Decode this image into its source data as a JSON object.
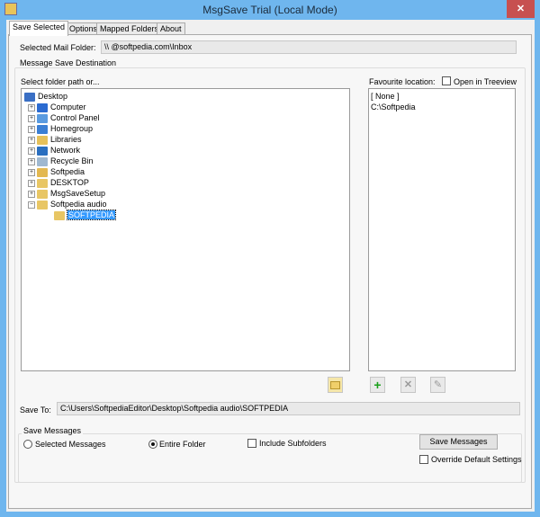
{
  "window": {
    "title": "MsgSave Trial (Local Mode)",
    "close": "✕"
  },
  "tabs": [
    {
      "label": "Save Selected",
      "active": true
    },
    {
      "label": "Options"
    },
    {
      "label": "Mapped Folders"
    },
    {
      "label": "About"
    }
  ],
  "mail_folder": {
    "label": "Selected Mail Folder:",
    "value": "\\\\      @softpedia.com\\Inbox"
  },
  "destination": {
    "group_label": "Message Save Destination",
    "tree_label": "Select folder path or...",
    "tree": [
      {
        "label": "Desktop",
        "icon": "desktop-icon",
        "level": 0,
        "color": "#3a6fc4"
      },
      {
        "label": "Computer",
        "icon": "computer-icon",
        "level": 1,
        "color": "#2b6bd1"
      },
      {
        "label": "Control Panel",
        "icon": "control-panel-icon",
        "level": 1,
        "color": "#5a9be0"
      },
      {
        "label": "Homegroup",
        "icon": "homegroup-icon",
        "level": 1,
        "color": "#3b7fd4"
      },
      {
        "label": "Libraries",
        "icon": "libraries-icon",
        "level": 1,
        "color": "#e6c15a"
      },
      {
        "label": "Network",
        "icon": "network-icon",
        "level": 1,
        "color": "#2a6fc0"
      },
      {
        "label": "Recycle Bin",
        "icon": "recycle-bin-icon",
        "level": 1,
        "color": "#9fb8d0"
      },
      {
        "label": "Softpedia",
        "icon": "user-folder-icon",
        "level": 1,
        "color": "#e3b850"
      },
      {
        "label": "DESKTOP",
        "icon": "folder-icon",
        "level": 1,
        "color": "#e8c664"
      },
      {
        "label": "MsgSaveSetup",
        "icon": "folder-icon",
        "level": 1,
        "color": "#e8c664"
      },
      {
        "label": "Softpedia audio",
        "icon": "folder-icon",
        "level": 1,
        "expanded": true,
        "color": "#e8c664"
      },
      {
        "label": "SOFTPEDIA",
        "icon": "folder-icon",
        "level": 2,
        "selected": true,
        "color": "#e8c664"
      }
    ],
    "favourite_label": "Favourite location:",
    "open_in_treeview": {
      "label": "Open in Treeview",
      "checked": false
    },
    "favourites": [
      "[ None ]",
      "C:\\Softpedia"
    ]
  },
  "toolbar": {
    "new_folder": "new-folder-icon",
    "add": "+",
    "remove": "✕",
    "edit": "✎"
  },
  "save_to": {
    "label": "Save To:",
    "value": "C:\\Users\\SoftpediaEditor\\Desktop\\Softpedia audio\\SOFTPEDIA"
  },
  "save_messages": {
    "group_label": "Save Messages",
    "radio_selected": {
      "label": "Selected Messages",
      "checked": false
    },
    "radio_entire": {
      "label": "Entire Folder",
      "checked": true
    },
    "include_subfolders": {
      "label": "Include Subfolders",
      "checked": false
    },
    "button": "Save Messages",
    "override": {
      "label": "Override Default Settings",
      "checked": false
    }
  }
}
